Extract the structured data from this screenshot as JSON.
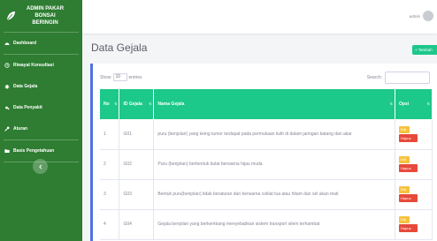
{
  "sidebar": {
    "brand_lines": [
      "ADMIN PAKAR",
      "BONSAI",
      "BERINGIN"
    ],
    "items": [
      {
        "label": "Dashboard",
        "icon": "tachometer-icon"
      },
      {
        "label": "Riwayat Konsultasi",
        "icon": "history-icon"
      },
      {
        "label": "Data Gejala",
        "icon": "bug-icon"
      },
      {
        "label": "Data Penyakit",
        "icon": "virus-icon"
      },
      {
        "label": "Aturan",
        "icon": "wrench-icon"
      },
      {
        "label": "Basis Pengetahuan",
        "icon": "folder-icon"
      }
    ],
    "toggle_icon": "chevron-left-icon"
  },
  "topbar": {
    "user_name": "admin"
  },
  "page": {
    "title": "Data Gejala",
    "add_button": "+ Tambah"
  },
  "datatable": {
    "show_label": "Show",
    "entries_value": "10",
    "entries_label": "entries",
    "search_label": "Search:",
    "columns": [
      "No",
      "ID Gejala",
      "Nama Gejala",
      "Opsi"
    ],
    "rows": [
      {
        "no": "1",
        "id": "G01",
        "nama": "puru (benjolan) yang keing tumor terdapat pada permukaan kulit di dalam jaringan batang dan akar"
      },
      {
        "no": "2",
        "id": "G02",
        "nama": "Puru (benjolan) berbentuk bulat berwarna hijau muda"
      },
      {
        "no": "3",
        "id": "G03",
        "nama": "Bentuk puru(benjolan) tidak beraturan dan berwarna coklat tua atau hitam dan sel akan mati"
      },
      {
        "no": "4",
        "id": "G04",
        "nama": "Gejala benjolan yang berkembang menyebabkan sistem transport xilem terhambat"
      }
    ],
    "edit_label": "Edit",
    "delete_label": "Hapus"
  },
  "colors": {
    "sidebar": "#2e7d32",
    "table_header": "#1cc88a",
    "edit": "#f6c23e",
    "delete": "#e74a3b",
    "card_accent": "#4e73df"
  }
}
